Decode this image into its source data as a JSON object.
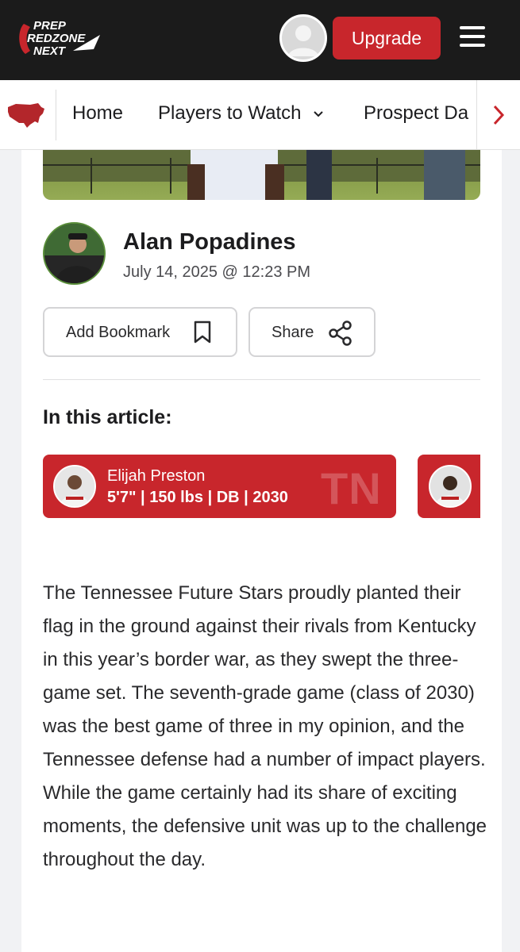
{
  "header": {
    "logo_lines": [
      "PREP",
      "REDZONE",
      "NEXT"
    ],
    "upgrade_label": "Upgrade",
    "colors": {
      "bar": "#1b1b1b",
      "accent": "#c8262c"
    }
  },
  "nav": {
    "items": [
      {
        "label": "Home"
      },
      {
        "label": "Players to Watch"
      },
      {
        "label": "Prospect Da"
      }
    ]
  },
  "article": {
    "author": {
      "name": "Alan Popadines",
      "date": "July 14, 2025 @ 12:23 PM"
    },
    "actions": {
      "bookmark_label": "Add Bookmark",
      "share_label": "Share"
    },
    "in_article_heading": "In this article:",
    "players": [
      {
        "name": "Elijah Preston",
        "meta": "5'7\" | 150 lbs | DB | 2030",
        "state": "TN"
      }
    ],
    "body": "The Tennessee Future Stars proudly planted their flag in the ground against their rivals from Kentucky in this year’s border war, as they swept the three-game set. The seventh-grade game (class of 2030) was the best game of three in my opinion, and the Tennessee defense had a number of impact players. While the game certainly had its share of exciting moments, the defensive unit was up to the challenge throughout the day."
  }
}
